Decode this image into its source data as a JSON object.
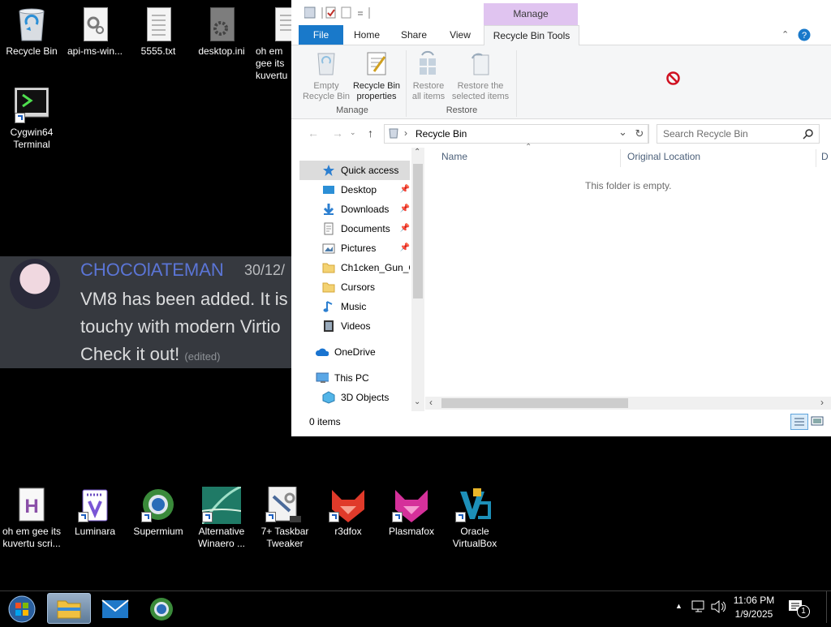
{
  "desktop": {
    "top_icons": [
      {
        "label": "Recycle Bin",
        "icon": "recycle-bin-icon"
      },
      {
        "label": "api-ms-win...",
        "icon": "system-file-icon"
      },
      {
        "label": "5555.txt",
        "icon": "text-file-icon"
      },
      {
        "label": "desktop.ini",
        "icon": "settings-file-icon"
      },
      {
        "label": "oh em gee its kuvertu",
        "icon": "text-file-icon"
      },
      {
        "label": "Cygwin64 Terminal",
        "icon": "terminal-icon"
      }
    ],
    "bottom_icons": [
      {
        "label": "oh em gee its kuvertu scri...",
        "icon": "script-file-icon"
      },
      {
        "label": "Luminara",
        "icon": "luminara-icon"
      },
      {
        "label": "Supermium",
        "icon": "supermium-browser-icon"
      },
      {
        "label": "Alternative Winaero ...",
        "icon": "winaero-icon"
      },
      {
        "label": "7+ Taskbar Tweaker",
        "icon": "taskbar-tweaker-icon"
      },
      {
        "label": "r3dfox",
        "icon": "r3dfox-icon"
      },
      {
        "label": "Plasmafox",
        "icon": "plasmafox-icon"
      },
      {
        "label": "Oracle VirtualBox",
        "icon": "virtualbox-icon"
      }
    ]
  },
  "chat": {
    "username": "CHOCOlATEMAN",
    "date": "30/12/",
    "lines": [
      "VM8 has been added. It is",
      "touchy with modern Virtio",
      "Check it out!"
    ],
    "edited": "(edited)"
  },
  "explorer": {
    "contextual_tab": "Manage",
    "tabs": {
      "file": "File",
      "home": "Home",
      "share": "Share",
      "view": "View",
      "tools": "Recycle Bin Tools"
    },
    "ribbon": {
      "empty": [
        "Empty",
        "Recycle Bin"
      ],
      "props": [
        "Recycle Bin",
        "properties"
      ],
      "restore_all": [
        "Restore",
        "all items"
      ],
      "restore_sel": [
        "Restore the",
        "selected items"
      ],
      "group_manage": "Manage",
      "group_restore": "Restore"
    },
    "address": "Recycle Bin",
    "search_placeholder": "Search Recycle Bin",
    "nav": [
      {
        "label": "Quick access",
        "pinned": false
      },
      {
        "label": "Desktop",
        "pinned": true
      },
      {
        "label": "Downloads",
        "pinned": true
      },
      {
        "label": "Documents",
        "pinned": true
      },
      {
        "label": "Pictures",
        "pinned": true
      },
      {
        "label": "Ch1cken_Gun_C",
        "pinned": false
      },
      {
        "label": "Cursors",
        "pinned": false
      },
      {
        "label": "Music",
        "pinned": false
      },
      {
        "label": "Videos",
        "pinned": false
      },
      {
        "label": "OneDrive",
        "pinned": false
      },
      {
        "label": "This PC",
        "pinned": false
      },
      {
        "label": "3D Objects",
        "pinned": false
      }
    ],
    "columns": {
      "name": "Name",
      "original_location": "Original Location",
      "date": "D"
    },
    "empty_message": "This folder is empty.",
    "status": "0 items"
  },
  "taskbar": {
    "time": "11:06 PM",
    "date": "1/9/2025",
    "notification_count": "1"
  }
}
